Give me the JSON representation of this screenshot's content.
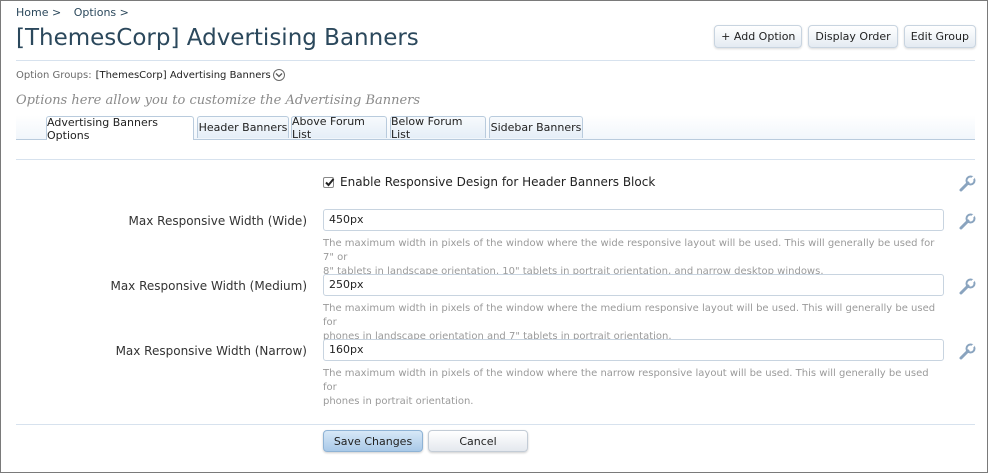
{
  "breadcrumb": [
    "Home >",
    "Options >"
  ],
  "page_title": "[ThemesCorp] Advertising Banners",
  "top_buttons": {
    "add_option": "+ Add Option",
    "display_order": "Display Order",
    "edit_group": "Edit Group"
  },
  "option_groups": {
    "label": "Option Groups:",
    "value": "[ThemesCorp] Advertising Banners"
  },
  "intro_text": "Options here allow you to customize the Advertising Banners",
  "tabs": [
    {
      "label": "Advertising Banners Options",
      "active": true
    },
    {
      "label": "Header Banners",
      "active": false
    },
    {
      "label": "Above Forum List",
      "active": false
    },
    {
      "label": "Below Forum List",
      "active": false
    },
    {
      "label": "Sidebar Banners",
      "active": false
    }
  ],
  "responsive_checkbox": {
    "label": "Enable Responsive Design for Header Banners Block",
    "checked": true
  },
  "fields": [
    {
      "label": "Max Responsive Width (Wide)",
      "value": "450px",
      "explain_line1": "The maximum width in pixels of the window where the wide responsive layout will be used. This will generally be used for 7\" or",
      "explain_line2": "8\" tablets in landscape orientation, 10\" tablets in portrait orientation, and narrow desktop windows."
    },
    {
      "label": "Max Responsive Width (Medium)",
      "value": "250px",
      "explain_line1": "The maximum width in pixels of the window where the medium responsive layout will be used. This will generally be used for",
      "explain_line2": "phones in landscape orientation and 7\" tablets in portrait orientation."
    },
    {
      "label": "Max Responsive Width (Narrow)",
      "value": "160px",
      "explain_line1": "The maximum width in pixels of the window where the narrow responsive layout will be used. This will generally be used for",
      "explain_line2": "phones in portrait orientation."
    }
  ],
  "actions": {
    "save": "Save Changes",
    "cancel": "Cancel"
  },
  "icons": {
    "edit_option": "wrench-icon",
    "expand_groups": "chevron-down-icon",
    "checkbox_state": "checkmark-icon"
  },
  "colors": {
    "title": "#2b485c",
    "tab_border": "#b9cbdd",
    "primary_button": "#a9c9e8"
  }
}
